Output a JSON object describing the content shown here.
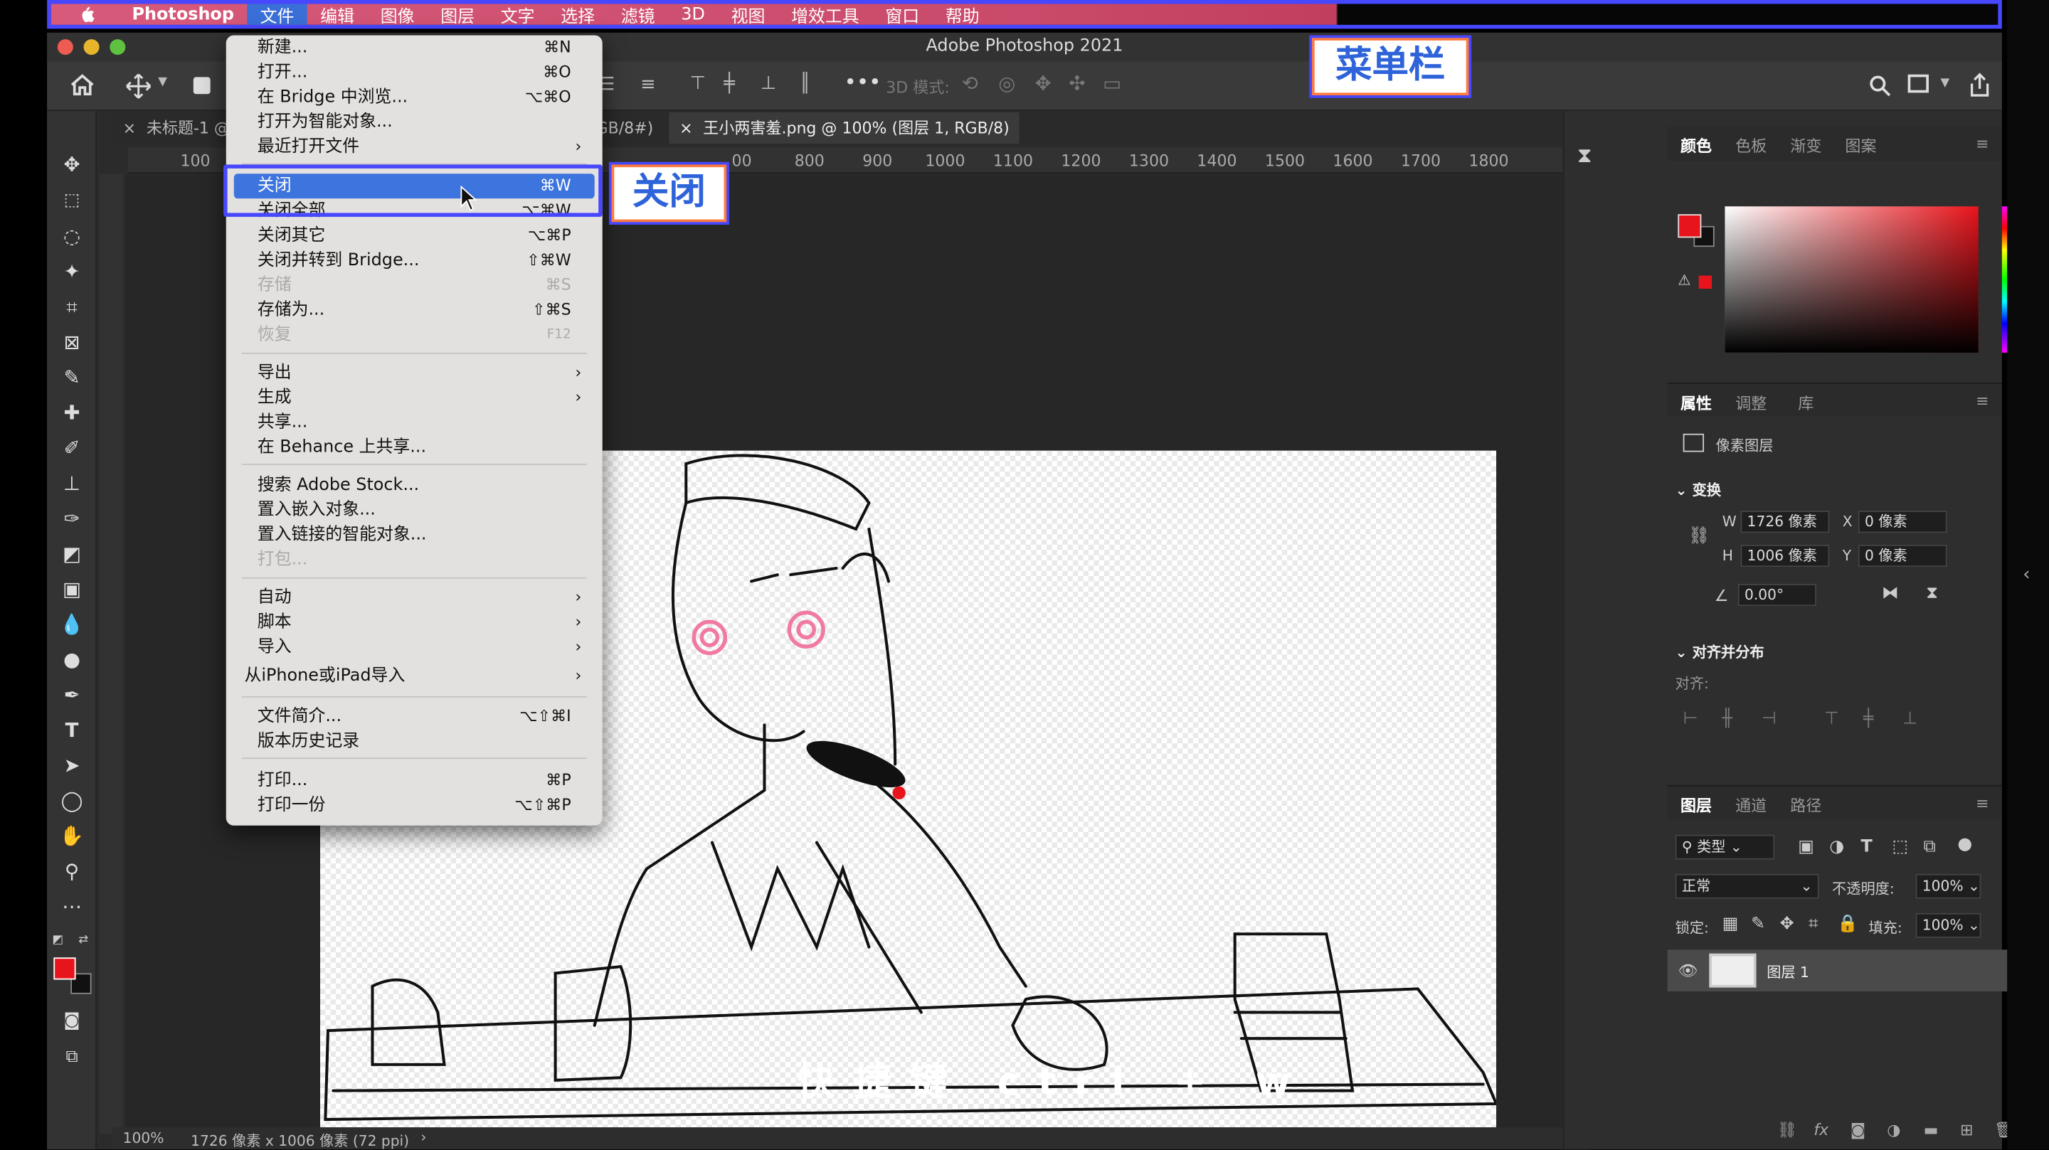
{
  "menubar": {
    "items": [
      "Photoshop",
      "文件",
      "编辑",
      "图像",
      "图层",
      "文字",
      "选择",
      "滤镜",
      "3D",
      "视图",
      "增效工具",
      "窗口",
      "帮助"
    ]
  },
  "window": {
    "title": "Adobe Photoshop 2021"
  },
  "options": {
    "mode3d": "3D 模式:"
  },
  "tabs": [
    {
      "label": "未标题-1 @"
    },
    {
      "label": "GB/8#)"
    },
    {
      "label": "王小两害羞.png @ 100% (图层 1, RGB/8)"
    }
  ],
  "ruler": {
    "top": [
      "100",
      "800",
      "900",
      "1000",
      "1100",
      "1200",
      "1300",
      "1400",
      "1500",
      "1600",
      "1700",
      "1800"
    ],
    "partial": "00"
  },
  "status": {
    "zoom": "100%",
    "info": "1726 像素 x 1006 像素 (72 ppi)"
  },
  "caption": "快捷键 ctrl + w",
  "callouts": {
    "menubar": "菜单栏",
    "close": "关闭"
  },
  "file_menu": {
    "group1": [
      {
        "label": "新建...",
        "shortcut": "⌘N"
      },
      {
        "label": "打开...",
        "shortcut": "⌘O"
      },
      {
        "label": "在 Bridge 中浏览...",
        "shortcut": "⌥⌘O"
      },
      {
        "label": "打开为智能对象...",
        "shortcut": ""
      },
      {
        "label": "最近打开文件",
        "shortcut": ""
      }
    ],
    "group2": [
      {
        "label": "关闭",
        "shortcut": "⌘W"
      },
      {
        "label": "关闭全部",
        "shortcut": "⌥⌘W"
      },
      {
        "label": "关闭其它",
        "shortcut": "⌥⌘P"
      },
      {
        "label": "关闭并转到 Bridge...",
        "shortcut": "⇧⌘W"
      },
      {
        "label": "存储",
        "shortcut": "⌘S"
      },
      {
        "label": "存储为...",
        "shortcut": "⇧⌘S"
      },
      {
        "label": "恢复",
        "shortcut": "F12"
      }
    ],
    "group3": [
      {
        "label": "导出"
      },
      {
        "label": "生成"
      },
      {
        "label": "共享..."
      },
      {
        "label": "在 Behance 上共享..."
      }
    ],
    "group4": [
      {
        "label": "搜索 Adobe Stock..."
      },
      {
        "label": "置入嵌入对象..."
      },
      {
        "label": "置入链接的智能对象..."
      },
      {
        "label": "打包..."
      }
    ],
    "group5": [
      {
        "label": "自动"
      },
      {
        "label": "脚本"
      },
      {
        "label": "导入"
      },
      {
        "label": "从iPhone或iPad导入"
      }
    ],
    "group6": [
      {
        "label": "文件简介...",
        "shortcut": "⌥⇧⌘I"
      },
      {
        "label": "版本历史记录",
        "shortcut": ""
      }
    ],
    "group7": [
      {
        "label": "打印...",
        "shortcut": "⌘P"
      },
      {
        "label": "打印一份",
        "shortcut": "⌥⇧⌘P"
      }
    ]
  },
  "panels": {
    "color_tabs": [
      "颜色",
      "色板",
      "渐变",
      "图案"
    ],
    "props_tabs": [
      "属性",
      "调整",
      "库"
    ],
    "pixel_layer": "像素图层",
    "transform": "变换",
    "w_label": "W",
    "w": "1726 像素",
    "x_label": "X",
    "x": "0 像素",
    "h_label": "H",
    "h": "1006 像素",
    "y_label": "Y",
    "y": "0 像素",
    "angle": "0.00°",
    "align_title": "对齐并分布",
    "align_label": "对齐:",
    "layer_tabs": [
      "图层",
      "通道",
      "路径"
    ],
    "filter": "类型",
    "blend": "正常",
    "opacity_label": "不透明度:",
    "opacity": "100%",
    "lock_label": "锁定:",
    "fill_label": "填充:",
    "fill": "100%",
    "layer_name": "图层 1"
  },
  "colors": {
    "foreground": "#e8141b",
    "menubar_accent": "#4747ff",
    "highlight": "#3d74de"
  }
}
